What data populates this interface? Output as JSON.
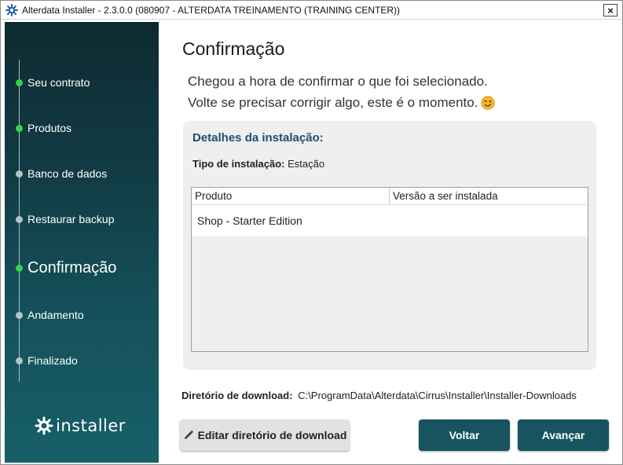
{
  "window": {
    "title": "Alterdata Installer - 2.3.0.0  (080907 - ALTERDATA TREINAMENTO (TRAINING CENTER))",
    "close_label": "×"
  },
  "sidebar": {
    "steps": [
      {
        "label": "Seu contrato",
        "state": "done"
      },
      {
        "label": "Produtos",
        "state": "done"
      },
      {
        "label": "Banco de dados",
        "state": "pending"
      },
      {
        "label": "Restaurar backup",
        "state": "pending"
      },
      {
        "label": "Confirmação",
        "state": "current"
      },
      {
        "label": "Andamento",
        "state": "pending"
      },
      {
        "label": "Finalizado",
        "state": "pending"
      }
    ],
    "logo_text": "installer"
  },
  "main": {
    "title": "Confirmação",
    "intro_line1": "Chegou a hora de confirmar o que foi selecionado.",
    "intro_line2": "Volte se precisar corrigir algo, este é o momento."
  },
  "details": {
    "heading": "Detalhes da instalação:",
    "install_type_label": "Tipo de instalação:",
    "install_type_value": "Estação",
    "table": {
      "columns": [
        "Produto",
        "Versão a ser instalada"
      ],
      "rows": [
        {
          "produto": "Shop - Starter Edition",
          "versao": ""
        }
      ]
    }
  },
  "download": {
    "label": "Diretório de download:",
    "path": "C:\\ProgramData\\Alterdata\\Cirrus\\Installer\\Installer-Downloads"
  },
  "buttons": {
    "edit_download_dir": "Editar diretório de download",
    "back": "Voltar",
    "next": "Avançar"
  },
  "colors": {
    "sidebar_top": "#0e2a31",
    "sidebar_bottom": "#176068",
    "step_done": "#2ed84a",
    "step_pending": "#b7c3c5",
    "primary_button": "#17545f",
    "heading_blue": "#1f4e6f"
  },
  "icons": {
    "title": "gear-snowflake-icon",
    "logo": "gear-icon",
    "emoji": "winking-face-icon",
    "edit": "pencil-icon"
  }
}
